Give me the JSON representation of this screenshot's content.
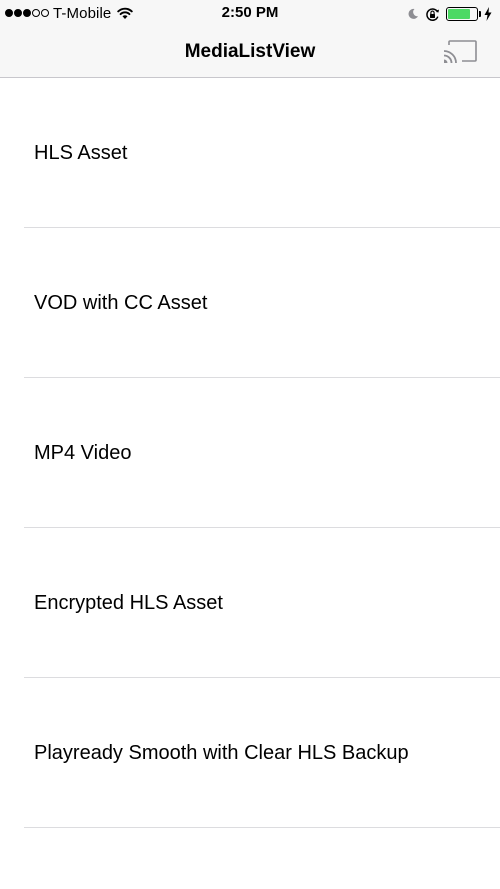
{
  "status_bar": {
    "signal_bars_filled": 3,
    "signal_bars_total": 5,
    "carrier": "T-Mobile",
    "wifi_icon": "wifi-icon",
    "time": "2:50 PM",
    "do_not_disturb_icon": "moon-icon",
    "orientation_lock_icon": "orientation-lock-icon",
    "battery_level": 0.8,
    "battery_color": "#4cd964",
    "charging_icon": "bolt-icon"
  },
  "nav_bar": {
    "title": "MediaListView",
    "cast_icon": "cast-icon"
  },
  "media_list": {
    "items": [
      {
        "label": "HLS Asset"
      },
      {
        "label": "VOD with CC Asset"
      },
      {
        "label": "MP4 Video"
      },
      {
        "label": "Encrypted HLS Asset"
      },
      {
        "label": "Playready Smooth with Clear HLS Backup"
      }
    ]
  }
}
